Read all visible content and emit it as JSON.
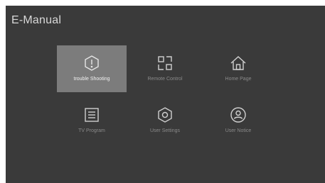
{
  "app": {
    "title": "E-Manual"
  },
  "menu": {
    "selected_index": 0,
    "items": [
      {
        "label": "trouble Shooting",
        "icon": "alert-icon"
      },
      {
        "label": "Remote Control",
        "icon": "remote-control-icon"
      },
      {
        "label": "Home Page",
        "icon": "home-icon"
      },
      {
        "label": "TV Program",
        "icon": "tv-program-icon"
      },
      {
        "label": "User Settings",
        "icon": "settings-icon"
      },
      {
        "label": "User Notice",
        "icon": "user-notice-icon"
      }
    ]
  },
  "colors": {
    "background": "#3a3a3a",
    "selected_tile": "#7c7c7c",
    "icon": "#d0d0d0",
    "label": "#8a8a8a"
  }
}
